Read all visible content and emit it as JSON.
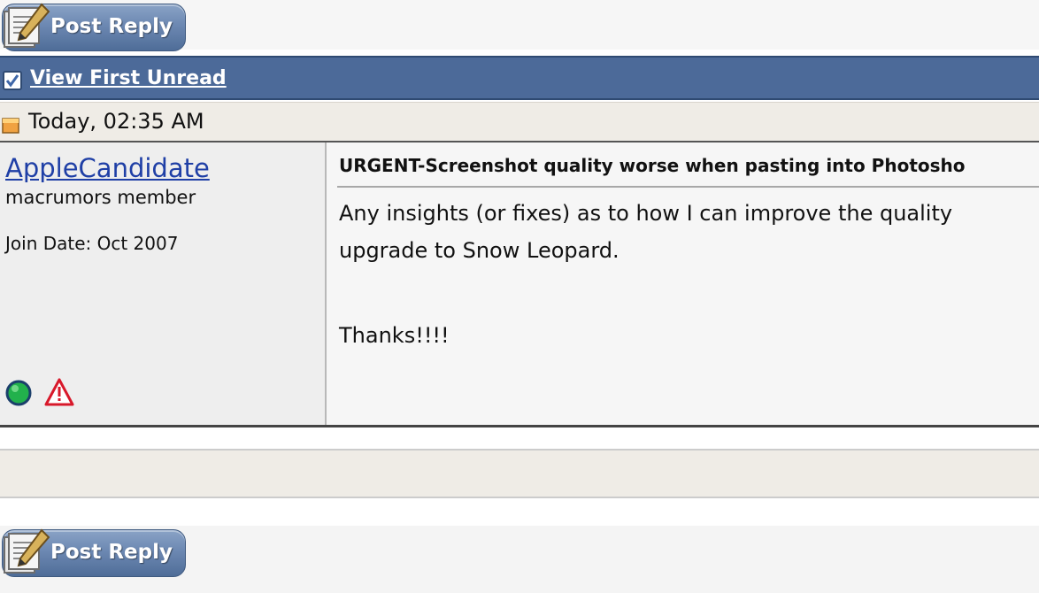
{
  "toolbar": {
    "post_reply_label": "Post Reply"
  },
  "thread_bar": {
    "view_first_unread": "View First Unread",
    "icon": "checkbox-icon",
    "color": "#4c6a99"
  },
  "post": {
    "date": "Today, 02:35 AM",
    "status_icon": "post-status-icon",
    "user": {
      "name": "AppleCandidate",
      "title": "macrumors member",
      "join_date": "Join Date: Oct 2007",
      "online_icon": "online-status-icon",
      "report_icon": "report-post-icon"
    },
    "message": {
      "title": "URGENT-Screenshot quality worse when pasting into Photosho",
      "lines": [
        "Any insights (or fixes) as to how I can improve the quality",
        "upgrade to Snow Leopard.",
        "Thanks!!!!"
      ]
    }
  },
  "footer": {
    "post_reply_label": "Post Reply"
  },
  "colors": {
    "link": "#1f3fa6",
    "button": "#6c88b2"
  }
}
